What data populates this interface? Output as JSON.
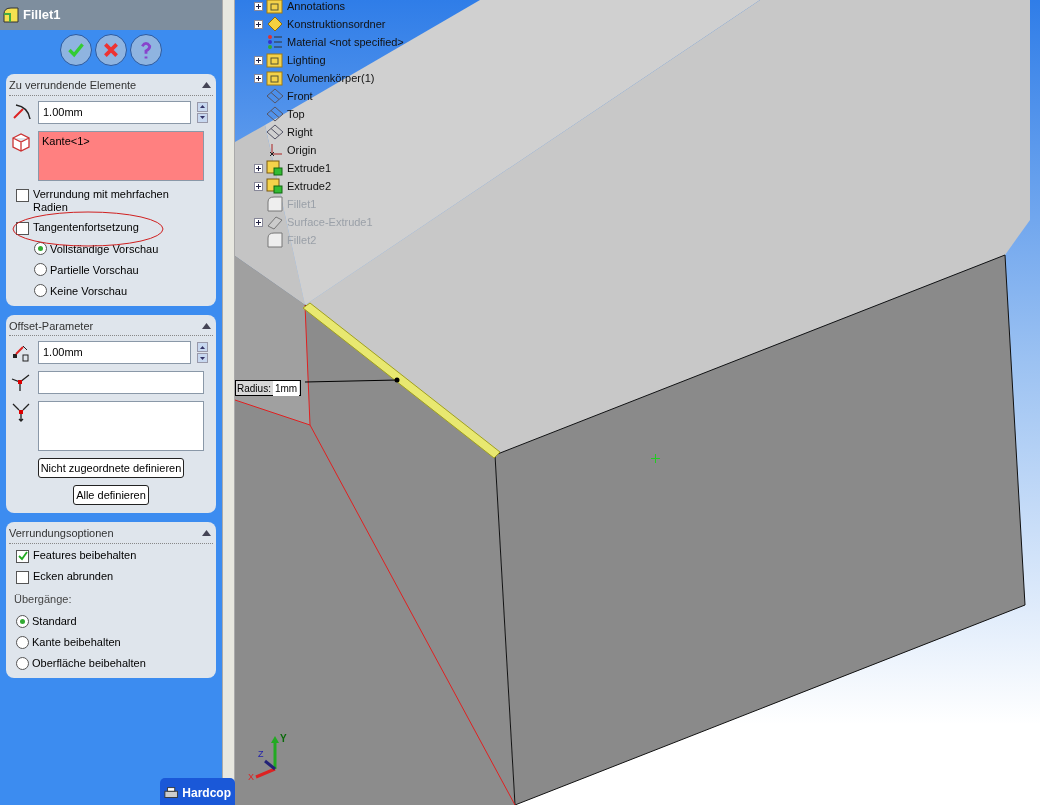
{
  "panel": {
    "title": "Fillet1",
    "actions": [
      {
        "kind": "ok"
      },
      {
        "kind": "cancel"
      },
      {
        "kind": "help"
      }
    ],
    "sections": [
      {
        "title": "Zu verrundende Elemente",
        "items": [
          {
            "kind": "spin",
            "value": "1.00mm"
          },
          {
            "kind": "list",
            "value": "Kante<1>",
            "highlighted": true
          },
          {
            "kind": "checkbox",
            "label": "Verrundung mit mehrfachen Radien",
            "checked": false,
            "circled": false
          },
          {
            "kind": "checkbox",
            "label": "Tangentenfortsetzung",
            "checked": false,
            "circled": true
          },
          {
            "kind": "radio",
            "label": "Vollständige Vorschau",
            "selected": true
          },
          {
            "kind": "radio",
            "label": "Partielle Vorschau",
            "selected": false
          },
          {
            "kind": "radio",
            "label": "Keine Vorschau",
            "selected": false
          }
        ]
      },
      {
        "title": "Offset-Parameter",
        "items": [
          {
            "kind": "spin",
            "value": "1.00mm"
          },
          {
            "kind": "field"
          },
          {
            "kind": "list",
            "highlighted": false
          },
          {
            "kind": "button",
            "label": "Nicht zugeordnete definieren"
          },
          {
            "kind": "button",
            "label": "Alle definieren"
          }
        ]
      },
      {
        "title": "Verrundungsoptionen",
        "items": [
          {
            "kind": "checkbox",
            "label": "Features beibehalten",
            "checked": true,
            "circled": false
          },
          {
            "kind": "checkbox",
            "label": "Ecken abrunden",
            "checked": false,
            "circled": false
          },
          {
            "kind": "label",
            "label": "Übergänge:"
          },
          {
            "kind": "radio",
            "label": "Standard",
            "selected": true
          },
          {
            "kind": "radio",
            "label": "Kante beibehalten",
            "selected": false
          },
          {
            "kind": "radio",
            "label": "Oberfläche beibehalten",
            "selected": false
          }
        ]
      }
    ]
  },
  "tree": [
    {
      "label": "Annotations",
      "kind": "folder",
      "expandable": true,
      "greyed": false
    },
    {
      "label": "Konstruktionsordner",
      "kind": "diamond",
      "expandable": true,
      "greyed": false
    },
    {
      "label": "Material <not specified>",
      "kind": "material",
      "expandable": false,
      "greyed": false
    },
    {
      "label": "Lighting",
      "kind": "folder",
      "expandable": true,
      "greyed": false
    },
    {
      "label": "Volumenkörper(1)",
      "kind": "folder",
      "expandable": true,
      "greyed": false
    },
    {
      "label": "Front",
      "kind": "plane",
      "expandable": false,
      "greyed": false
    },
    {
      "label": "Top",
      "kind": "plane",
      "expandable": false,
      "greyed": false
    },
    {
      "label": "Right",
      "kind": "plane",
      "expandable": false,
      "greyed": false
    },
    {
      "label": "Origin",
      "kind": "origin",
      "expandable": false,
      "greyed": false
    },
    {
      "label": "Extrude1",
      "kind": "feature",
      "expandable": true,
      "greyed": false
    },
    {
      "label": "Extrude2",
      "kind": "feature",
      "expandable": true,
      "greyed": false
    },
    {
      "label": "Fillet1",
      "kind": "fillet",
      "expandable": false,
      "greyed": true
    },
    {
      "label": "Surface-Extrude1",
      "kind": "surface",
      "expandable": true,
      "greyed": true
    },
    {
      "label": "Fillet2",
      "kind": "fillet",
      "expandable": false,
      "greyed": true
    }
  ],
  "callout": {
    "label": "Radius:",
    "value": "1mm"
  },
  "triad": {
    "x": "X",
    "y": "Y",
    "z": "Z"
  },
  "taskbar_window": {
    "title": "Hardcop"
  }
}
